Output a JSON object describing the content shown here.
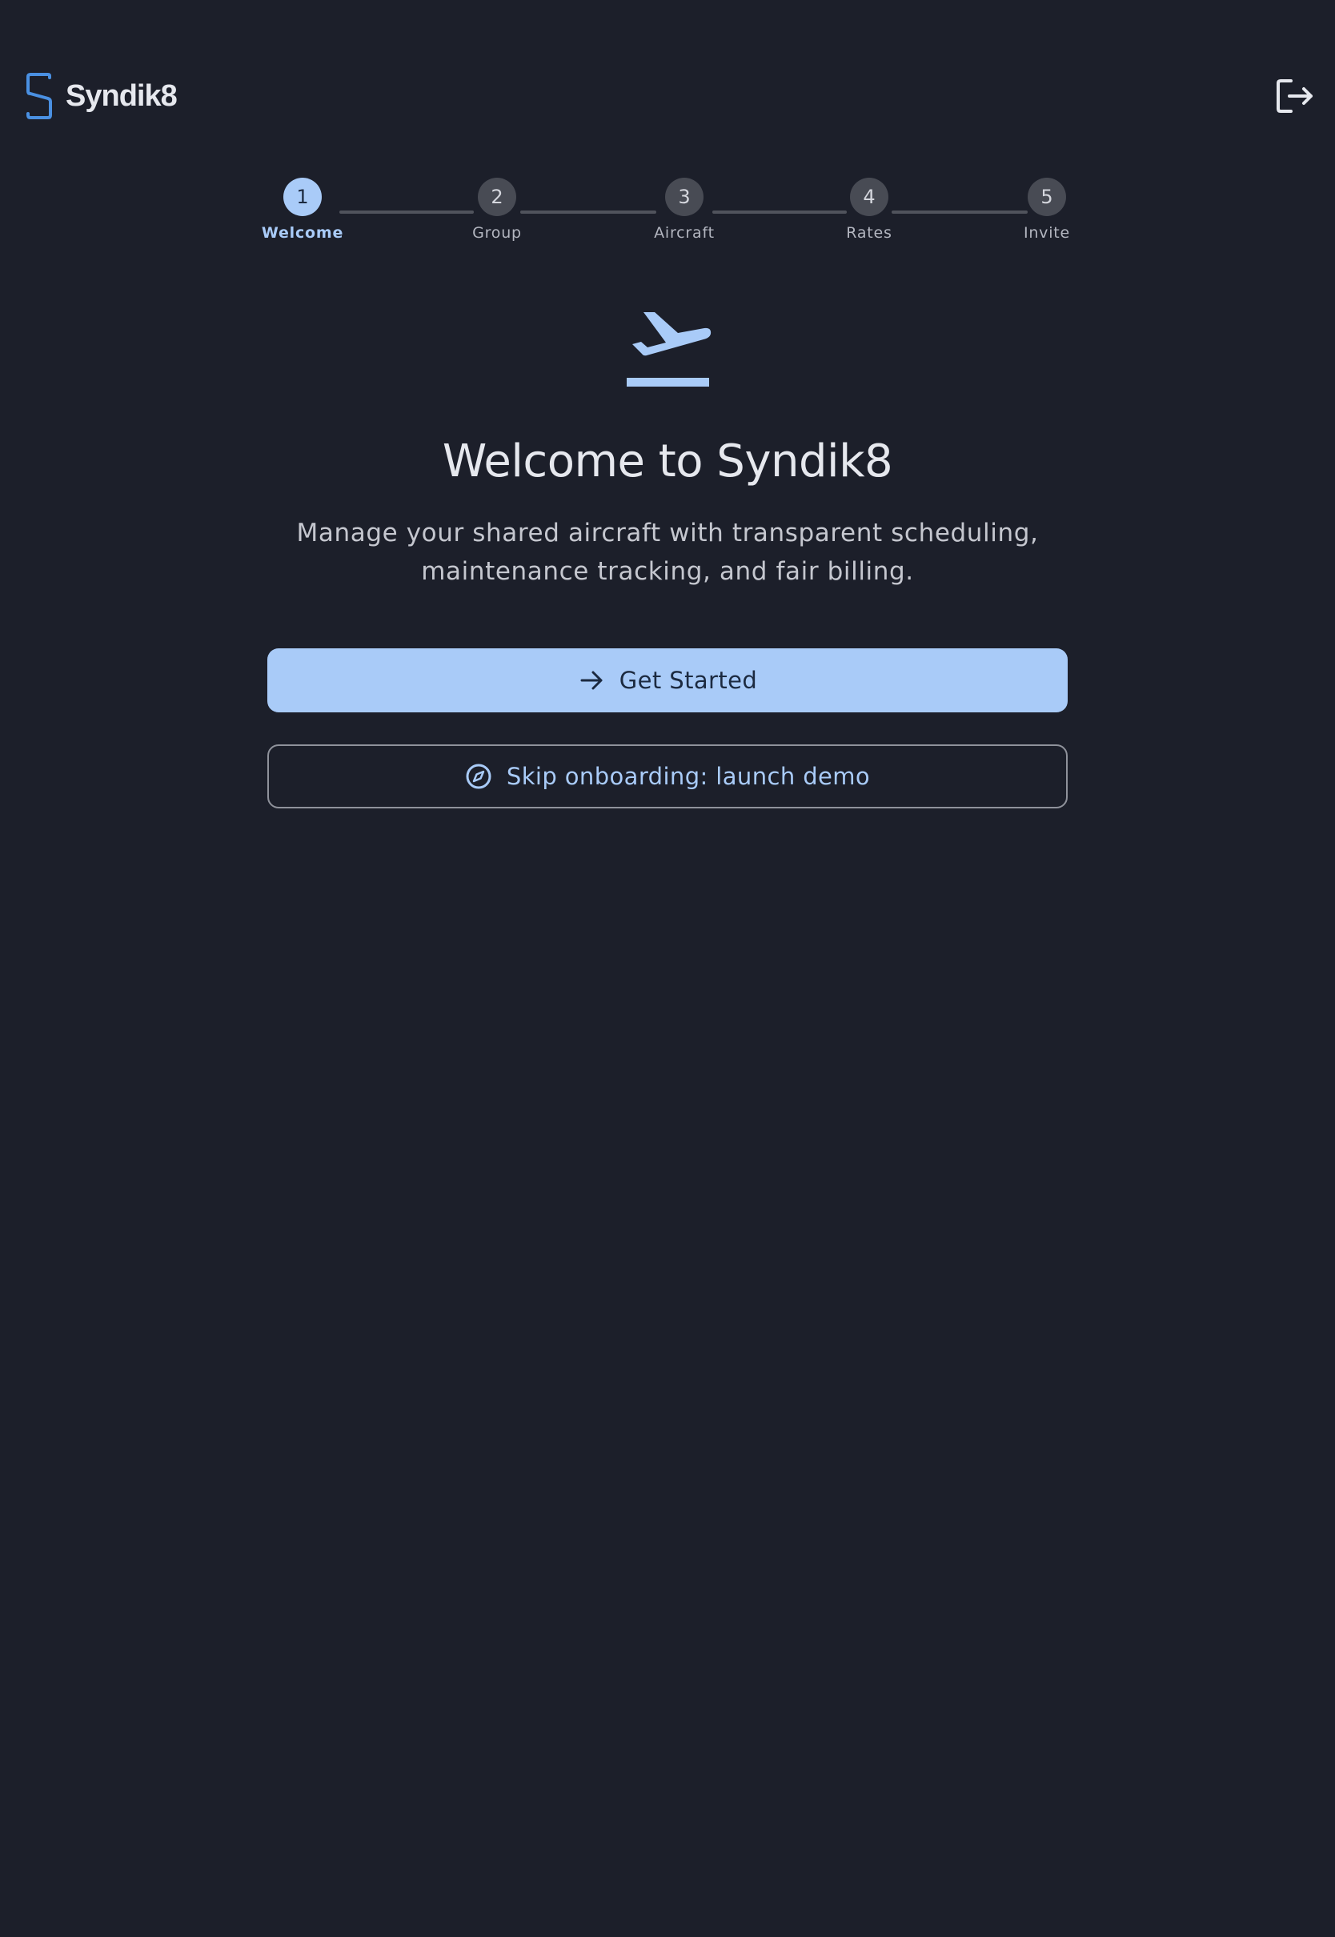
{
  "app": {
    "name": "Syndik8",
    "logo_icon": "syndik8-logo-icon",
    "logout_icon": "logout-icon"
  },
  "stepper": {
    "steps": [
      {
        "number": "1",
        "label": "Welcome",
        "active": true
      },
      {
        "number": "2",
        "label": "Group",
        "active": false
      },
      {
        "number": "3",
        "label": "Aircraft",
        "active": false
      },
      {
        "number": "4",
        "label": "Rates",
        "active": false
      },
      {
        "number": "5",
        "label": "Invite",
        "active": false
      }
    ]
  },
  "hero": {
    "icon": "flight-takeoff-icon",
    "title": "Welcome to Syndik8",
    "subtitle": "Manage your shared aircraft with transparent scheduling, maintenance tracking, and fair billing."
  },
  "actions": {
    "get_started": {
      "label": "Get Started",
      "icon": "arrow-right-icon"
    },
    "skip": {
      "label": "Skip onboarding: launch demo",
      "icon": "compass-icon"
    }
  },
  "colors": {
    "background": "#1c1f2a",
    "accent": "#a9cbf8",
    "logo": "#4a90e2",
    "step_inactive": "#484b54",
    "text_primary": "#e6e8ee",
    "text_secondary": "#c5c7cf"
  }
}
